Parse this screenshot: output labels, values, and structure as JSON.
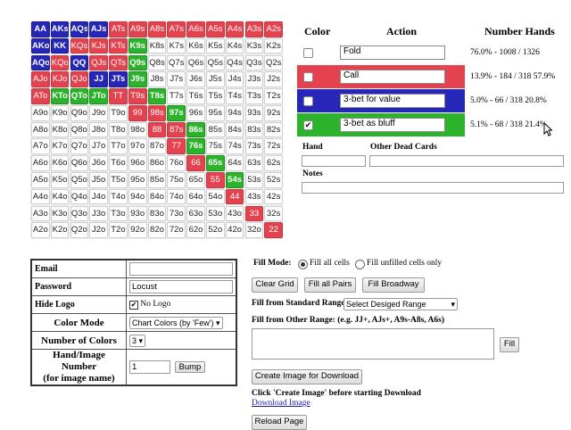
{
  "grid": [
    [
      {
        "t": "AA",
        "c": "blue"
      },
      {
        "t": "AKs",
        "c": "blue"
      },
      {
        "t": "AQs",
        "c": "blue"
      },
      {
        "t": "AJs",
        "c": "blue"
      },
      {
        "t": "ATs",
        "c": "red"
      },
      {
        "t": "A9s",
        "c": "red"
      },
      {
        "t": "A8s",
        "c": "red"
      },
      {
        "t": "A7s",
        "c": "red"
      },
      {
        "t": "A6s",
        "c": "red"
      },
      {
        "t": "A5s",
        "c": "red"
      },
      {
        "t": "A4s",
        "c": "red"
      },
      {
        "t": "A3s",
        "c": "red"
      },
      {
        "t": "A2s",
        "c": "red"
      }
    ],
    [
      {
        "t": "AKo",
        "c": "blue"
      },
      {
        "t": "KK",
        "c": "blue"
      },
      {
        "t": "KQs",
        "c": "red"
      },
      {
        "t": "KJs",
        "c": "red"
      },
      {
        "t": "KTs",
        "c": "red"
      },
      {
        "t": "K9s",
        "c": "green"
      },
      {
        "t": "K8s",
        "c": ""
      },
      {
        "t": "K7s",
        "c": ""
      },
      {
        "t": "K6s",
        "c": ""
      },
      {
        "t": "K5s",
        "c": ""
      },
      {
        "t": "K4s",
        "c": ""
      },
      {
        "t": "K3s",
        "c": ""
      },
      {
        "t": "K2s",
        "c": ""
      }
    ],
    [
      {
        "t": "AQo",
        "c": "blue"
      },
      {
        "t": "KQo",
        "c": "red"
      },
      {
        "t": "QQ",
        "c": "blue"
      },
      {
        "t": "QJs",
        "c": "red"
      },
      {
        "t": "QTs",
        "c": "red"
      },
      {
        "t": "Q9s",
        "c": "green"
      },
      {
        "t": "Q8s",
        "c": ""
      },
      {
        "t": "Q7s",
        "c": ""
      },
      {
        "t": "Q6s",
        "c": ""
      },
      {
        "t": "Q5s",
        "c": ""
      },
      {
        "t": "Q4s",
        "c": ""
      },
      {
        "t": "Q3s",
        "c": ""
      },
      {
        "t": "Q2s",
        "c": ""
      }
    ],
    [
      {
        "t": "AJo",
        "c": "red"
      },
      {
        "t": "KJo",
        "c": "red"
      },
      {
        "t": "QJo",
        "c": "red"
      },
      {
        "t": "JJ",
        "c": "blue"
      },
      {
        "t": "JTs",
        "c": "blue"
      },
      {
        "t": "J9s",
        "c": "green"
      },
      {
        "t": "J8s",
        "c": ""
      },
      {
        "t": "J7s",
        "c": ""
      },
      {
        "t": "J6s",
        "c": ""
      },
      {
        "t": "J5s",
        "c": ""
      },
      {
        "t": "J4s",
        "c": ""
      },
      {
        "t": "J3s",
        "c": ""
      },
      {
        "t": "J2s",
        "c": ""
      }
    ],
    [
      {
        "t": "ATo",
        "c": "red"
      },
      {
        "t": "KTo",
        "c": "green"
      },
      {
        "t": "QTo",
        "c": "green"
      },
      {
        "t": "JTo",
        "c": "green"
      },
      {
        "t": "TT",
        "c": "red"
      },
      {
        "t": "T9s",
        "c": "red"
      },
      {
        "t": "T8s",
        "c": "green"
      },
      {
        "t": "T7s",
        "c": ""
      },
      {
        "t": "T6s",
        "c": ""
      },
      {
        "t": "T5s",
        "c": ""
      },
      {
        "t": "T4s",
        "c": ""
      },
      {
        "t": "T3s",
        "c": ""
      },
      {
        "t": "T2s",
        "c": ""
      }
    ],
    [
      {
        "t": "A9o",
        "c": ""
      },
      {
        "t": "K9o",
        "c": ""
      },
      {
        "t": "Q9o",
        "c": ""
      },
      {
        "t": "J9o",
        "c": ""
      },
      {
        "t": "T9o",
        "c": ""
      },
      {
        "t": "99",
        "c": "red"
      },
      {
        "t": "98s",
        "c": "red"
      },
      {
        "t": "97s",
        "c": "green"
      },
      {
        "t": "96s",
        "c": ""
      },
      {
        "t": "95s",
        "c": ""
      },
      {
        "t": "94s",
        "c": ""
      },
      {
        "t": "93s",
        "c": ""
      },
      {
        "t": "92s",
        "c": ""
      }
    ],
    [
      {
        "t": "A8o",
        "c": ""
      },
      {
        "t": "K8o",
        "c": ""
      },
      {
        "t": "Q8o",
        "c": ""
      },
      {
        "t": "J8o",
        "c": ""
      },
      {
        "t": "T8o",
        "c": ""
      },
      {
        "t": "98o",
        "c": ""
      },
      {
        "t": "88",
        "c": "red"
      },
      {
        "t": "87s",
        "c": "red"
      },
      {
        "t": "86s",
        "c": "green"
      },
      {
        "t": "85s",
        "c": ""
      },
      {
        "t": "84s",
        "c": ""
      },
      {
        "t": "83s",
        "c": ""
      },
      {
        "t": "82s",
        "c": ""
      }
    ],
    [
      {
        "t": "A7o",
        "c": ""
      },
      {
        "t": "K7o",
        "c": ""
      },
      {
        "t": "Q7o",
        "c": ""
      },
      {
        "t": "J7o",
        "c": ""
      },
      {
        "t": "T7o",
        "c": ""
      },
      {
        "t": "97o",
        "c": ""
      },
      {
        "t": "87o",
        "c": ""
      },
      {
        "t": "77",
        "c": "red"
      },
      {
        "t": "76s",
        "c": "green"
      },
      {
        "t": "75s",
        "c": ""
      },
      {
        "t": "74s",
        "c": ""
      },
      {
        "t": "73s",
        "c": ""
      },
      {
        "t": "72s",
        "c": ""
      }
    ],
    [
      {
        "t": "A6o",
        "c": ""
      },
      {
        "t": "K6o",
        "c": ""
      },
      {
        "t": "Q6o",
        "c": ""
      },
      {
        "t": "J6o",
        "c": ""
      },
      {
        "t": "T6o",
        "c": ""
      },
      {
        "t": "96o",
        "c": ""
      },
      {
        "t": "86o",
        "c": ""
      },
      {
        "t": "76o",
        "c": ""
      },
      {
        "t": "66",
        "c": "red"
      },
      {
        "t": "65s",
        "c": "green"
      },
      {
        "t": "64s",
        "c": ""
      },
      {
        "t": "63s",
        "c": ""
      },
      {
        "t": "62s",
        "c": ""
      }
    ],
    [
      {
        "t": "A5o",
        "c": ""
      },
      {
        "t": "K5o",
        "c": ""
      },
      {
        "t": "Q5o",
        "c": ""
      },
      {
        "t": "J5o",
        "c": ""
      },
      {
        "t": "T5o",
        "c": ""
      },
      {
        "t": "95o",
        "c": ""
      },
      {
        "t": "85o",
        "c": ""
      },
      {
        "t": "75o",
        "c": ""
      },
      {
        "t": "65o",
        "c": ""
      },
      {
        "t": "55",
        "c": "red"
      },
      {
        "t": "54s",
        "c": "green"
      },
      {
        "t": "53s",
        "c": ""
      },
      {
        "t": "52s",
        "c": ""
      }
    ],
    [
      {
        "t": "A4o",
        "c": ""
      },
      {
        "t": "K4o",
        "c": ""
      },
      {
        "t": "Q4o",
        "c": ""
      },
      {
        "t": "J4o",
        "c": ""
      },
      {
        "t": "T4o",
        "c": ""
      },
      {
        "t": "94o",
        "c": ""
      },
      {
        "t": "84o",
        "c": ""
      },
      {
        "t": "74o",
        "c": ""
      },
      {
        "t": "64o",
        "c": ""
      },
      {
        "t": "54o",
        "c": ""
      },
      {
        "t": "44",
        "c": "red"
      },
      {
        "t": "43s",
        "c": ""
      },
      {
        "t": "42s",
        "c": ""
      }
    ],
    [
      {
        "t": "A3o",
        "c": ""
      },
      {
        "t": "K3o",
        "c": ""
      },
      {
        "t": "Q3o",
        "c": ""
      },
      {
        "t": "J3o",
        "c": ""
      },
      {
        "t": "T3o",
        "c": ""
      },
      {
        "t": "93o",
        "c": ""
      },
      {
        "t": "83o",
        "c": ""
      },
      {
        "t": "73o",
        "c": ""
      },
      {
        "t": "63o",
        "c": ""
      },
      {
        "t": "53o",
        "c": ""
      },
      {
        "t": "43o",
        "c": ""
      },
      {
        "t": "33",
        "c": "red"
      },
      {
        "t": "32s",
        "c": ""
      }
    ],
    [
      {
        "t": "A2o",
        "c": ""
      },
      {
        "t": "K2o",
        "c": ""
      },
      {
        "t": "Q2o",
        "c": ""
      },
      {
        "t": "J2o",
        "c": ""
      },
      {
        "t": "T2o",
        "c": ""
      },
      {
        "t": "92o",
        "c": ""
      },
      {
        "t": "82o",
        "c": ""
      },
      {
        "t": "72o",
        "c": ""
      },
      {
        "t": "62o",
        "c": ""
      },
      {
        "t": "52o",
        "c": ""
      },
      {
        "t": "42o",
        "c": ""
      },
      {
        "t": "32o",
        "c": ""
      },
      {
        "t": "22",
        "c": "red"
      }
    ]
  ],
  "actions_panel": {
    "col_color": "Color",
    "col_action": "Action",
    "col_number_hands": "Number Hands",
    "rows": [
      {
        "value": "Fold",
        "stat": "76.0% - 1008 / 1326",
        "checked": false
      },
      {
        "value": "Call",
        "stat": "13.9% - 184 / 318 57.9%",
        "checked": false
      },
      {
        "value": "3-bet for value",
        "stat": "5.0% - 66 / 318 20.8%",
        "checked": false
      },
      {
        "value": "3-bet as bluff",
        "stat": "5.1% - 68 / 318 21.4%",
        "checked": true
      }
    ],
    "hand_label": "Hand",
    "dead_cards_label": "Other Dead Cards",
    "notes_label": "Notes"
  },
  "settings": {
    "email_label": "Email",
    "email_value": "",
    "password_label": "Password",
    "password_value": "Locust",
    "hide_logo_label": "Hide Logo",
    "no_logo_label": "No Logo",
    "color_mode_label": "Color Mode",
    "color_mode_value": "Chart Colors (by 'Few')",
    "num_colors_label": "Number of Colors",
    "num_colors_value": "3",
    "hand_image_label_line1": "Hand/Image Number",
    "hand_image_label_line2": "(for image name)",
    "hand_image_value": "1",
    "bump_label": "Bump"
  },
  "fill": {
    "fill_mode_label": "Fill Mode:",
    "fill_all_cells": "Fill all cells",
    "fill_unfilled": "Fill unfilled cells only",
    "clear_grid": "Clear Grid",
    "fill_all_pairs": "Fill all Pairs",
    "fill_broadway": "Fill Broadway",
    "standard_ranges_label": "Fill from Standard Ranges:",
    "standard_ranges_value": "Select Desiged Range",
    "other_range_label": "Fill from Other Range: (e.g. JJ+, AJs+, A9s-A8s, A6s)",
    "fill_button": "Fill",
    "create_image": "Create Image for Download",
    "create_note": "Click 'Create Image' before starting Download",
    "download_link": "Download Image",
    "reload_page": "Reload Page"
  }
}
